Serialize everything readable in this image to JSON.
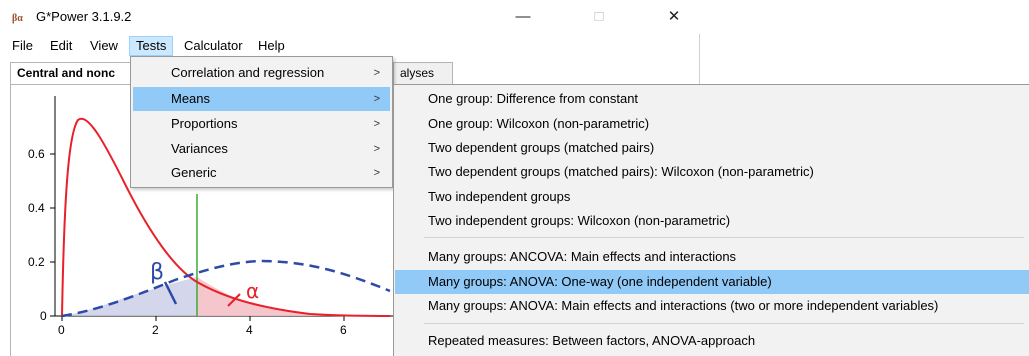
{
  "window": {
    "title": "G*Power 3.1.9.2",
    "minimize": "—",
    "maximize": "□",
    "close": "✕"
  },
  "menubar": {
    "items": [
      "File",
      "Edit",
      "View",
      "Tests",
      "Calculator",
      "Help"
    ]
  },
  "tabs": {
    "main": "Central and nonc",
    "secondary": "alyses"
  },
  "plot": {
    "y_ticks": [
      "0.6",
      "0.4",
      "0.2",
      "0"
    ],
    "x_ticks": [
      "0",
      "2",
      "4",
      "6"
    ],
    "beta_label": "β",
    "alpha_label": "α",
    "colors": {
      "central": "#e8202a",
      "noncentral": "#2e4aa8",
      "critical": "#3aaa35"
    }
  },
  "tests_menu": {
    "items": [
      {
        "label": "Correlation and regression",
        "has_submenu": true
      },
      {
        "label": "Means",
        "has_submenu": true,
        "highlighted": true
      },
      {
        "label": "Proportions",
        "has_submenu": true
      },
      {
        "label": "Variances",
        "has_submenu": true
      },
      {
        "label": "Generic",
        "has_submenu": true
      }
    ],
    "arrow": ">"
  },
  "means_submenu": {
    "items": [
      {
        "label": "One group: Difference from constant"
      },
      {
        "label": "One group: Wilcoxon (non-parametric)"
      },
      {
        "label": "Two dependent groups (matched pairs)"
      },
      {
        "label": "Two dependent groups (matched pairs): Wilcoxon (non-parametric)"
      },
      {
        "label": "Two independent groups"
      },
      {
        "label": "Two independent groups: Wilcoxon (non-parametric)"
      },
      {
        "label": "Many groups: ANCOVA: Main effects and interactions"
      },
      {
        "label": "Many groups: ANOVA: One-way (one independent variable)",
        "highlighted": true
      },
      {
        "label": "Many groups: ANOVA: Main effects and interactions (two or more independent variables)"
      },
      {
        "label": "Repeated measures: Between factors, ANOVA-approach"
      }
    ]
  }
}
